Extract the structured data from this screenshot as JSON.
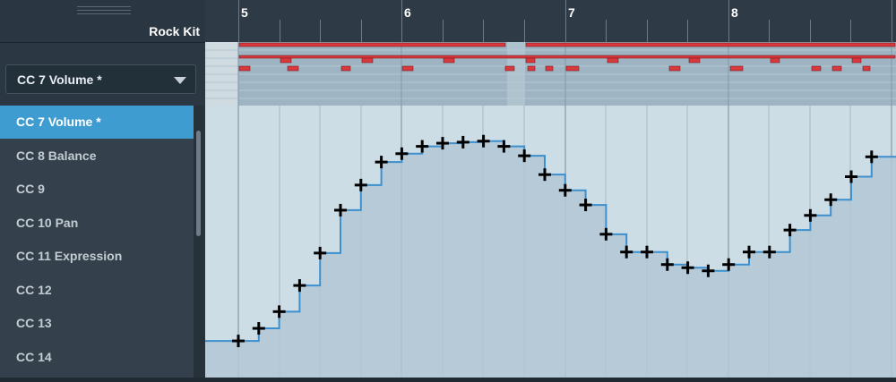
{
  "track": {
    "name": "Rock Kit"
  },
  "ruler": {
    "bars": [
      "5",
      "6",
      "7",
      "8"
    ]
  },
  "dropdown": {
    "selected": "CC 7 Volume *"
  },
  "cc_list": [
    "CC 7 Volume *",
    "CC 8 Balance",
    "CC 9",
    "CC 10 Pan",
    "CC 11 Expression",
    "CC 12",
    "CC 13",
    "CC 14"
  ],
  "colors": {
    "selection": "#3f9cd1",
    "curve": "#3d8fcd",
    "note": "#d9383d",
    "fill": "#b1c8d4"
  },
  "icons": [
    "chevron-down-icon",
    "plus-marker-icon"
  ],
  "cc_curve": {
    "ylim": [
      0,
      127
    ],
    "points": [
      {
        "beat": 0,
        "value": 35
      },
      {
        "beat": 0.25,
        "value": 47
      },
      {
        "beat": 0.5,
        "value": 63
      },
      {
        "beat": 0.75,
        "value": 88
      },
      {
        "beat": 1,
        "value": 119
      },
      {
        "beat": 1.25,
        "value": 160
      },
      {
        "beat": 1.5,
        "value": 184
      },
      {
        "beat": 1.75,
        "value": 206
      },
      {
        "beat": 2,
        "value": 214
      },
      {
        "beat": 2.25,
        "value": 221
      },
      {
        "beat": 2.5,
        "value": 224
      },
      {
        "beat": 2.75,
        "value": 225
      },
      {
        "beat": 3,
        "value": 226
      },
      {
        "beat": 3.25,
        "value": 221
      },
      {
        "beat": 3.5,
        "value": 212
      },
      {
        "beat": 3.75,
        "value": 194
      },
      {
        "beat": 4,
        "value": 179
      },
      {
        "beat": 4.25,
        "value": 165
      },
      {
        "beat": 4.5,
        "value": 137
      },
      {
        "beat": 4.75,
        "value": 120
      },
      {
        "beat": 5,
        "value": 120
      },
      {
        "beat": 5.25,
        "value": 108
      },
      {
        "beat": 5.5,
        "value": 105
      },
      {
        "beat": 5.75,
        "value": 102
      },
      {
        "beat": 6,
        "value": 108
      },
      {
        "beat": 6.25,
        "value": 120
      },
      {
        "beat": 6.5,
        "value": 120
      },
      {
        "beat": 6.75,
        "value": 141
      },
      {
        "beat": 7,
        "value": 155
      },
      {
        "beat": 7.25,
        "value": 170
      },
      {
        "beat": 7.5,
        "value": 192
      },
      {
        "beat": 7.75,
        "value": 211
      }
    ]
  }
}
